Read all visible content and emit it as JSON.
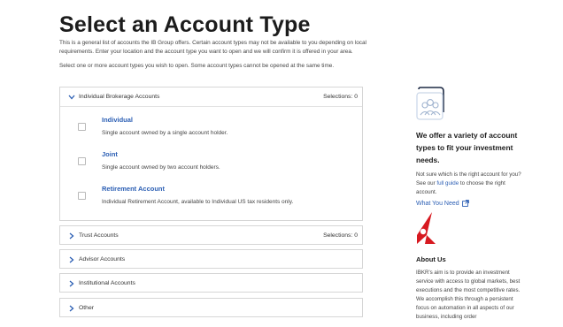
{
  "page": {
    "title": "Select an Account Type",
    "intro_1": "This is a general list of accounts the IB Group offers. Certain account types may not be available to you depending on local requirements. Enter your location and the account type you want to open and we will confirm it is offered in your area.",
    "intro_2": "Select one or more account types you wish to open. Some account types cannot be opened at the same time."
  },
  "accordions": [
    {
      "label": "Individual Brokerage Accounts",
      "selections": "Selections: 0",
      "expanded": true,
      "options": [
        {
          "name": "Individual",
          "desc": "Single account owned by a single account holder."
        },
        {
          "name": "Joint",
          "desc": "Single account owned by two account holders."
        },
        {
          "name": "Retirement Account",
          "desc": "Individual Retirement Account, available to Individual US tax residents only."
        }
      ]
    },
    {
      "label": "Trust Accounts",
      "selections": "Selections: 0",
      "expanded": false
    },
    {
      "label": "Advisor Accounts",
      "selections": "",
      "expanded": false
    },
    {
      "label": "Institutional Accounts",
      "selections": "",
      "expanded": false
    },
    {
      "label": "Other",
      "selections": "",
      "expanded": false
    }
  ],
  "sidebar": {
    "icon": "people-folder-icon",
    "heading": "We offer a variety of account types to fit your investment needs.",
    "text_before": "Not sure which is the right account for you? See our ",
    "text_link": "full guide",
    "text_after": " to choose the right account.",
    "what_you_need": "What You Need",
    "about_title": "About Us",
    "about_text": "IBKR's aim is to provide an investment service with access to global markets, best executions and the most competitive rates. We accomplish this through a persistent focus on automation in all aspects of our business, including order"
  },
  "colors": {
    "accent": "#2c5fb4",
    "logo_red": "#d71920"
  }
}
